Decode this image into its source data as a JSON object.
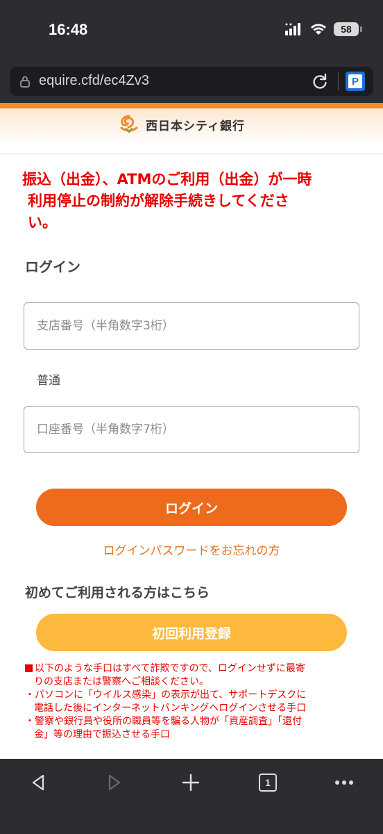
{
  "status_bar": {
    "time": "16:48",
    "battery": "58"
  },
  "browser": {
    "url": "equire.cfd/ec4Zv3"
  },
  "header": {
    "bank_name": "西日本シティ銀行"
  },
  "notice": {
    "line1": "振込（出金）、ATMのご利用（出金）が一時",
    "line2": "利用停止の制約が解除手続きしてくださ",
    "line3": "い。"
  },
  "login": {
    "heading": "ログイン",
    "branch_placeholder": "支店番号（半角数字3桁）",
    "account_type": "普通",
    "account_placeholder": "口座番号（半角数字7桁）",
    "button_label": "ログイン",
    "forgot_link": "ログインパスワードをお忘れの方"
  },
  "first_time": {
    "heading": "初めてご利用される方はこちら",
    "register_label": "初回利用登録"
  },
  "warnings": {
    "lead_line1": "以下のような手口はすべて詐欺ですので、ログインせずに最寄",
    "lead_line2": "りの支店または警察へご相談ください。",
    "item1_line1": "・パソコンに「ウイルス感染」の表示が出て、サポートデスクに",
    "item1_line2": "電話した後にインターネットバンキングへログインさせる手口",
    "item2_line1": "・警察や銀行員や役所の職員等を騙る人物が「資産調査」「還付",
    "item2_line2": "金」等の理由で振込させる手口"
  },
  "toolbar": {
    "tab_count": "1"
  },
  "colors": {
    "brand_orange": "#ee6a1d",
    "register_yellow": "#fdb93e",
    "warning_red": "#e60000",
    "link_orange": "#e2741f"
  }
}
